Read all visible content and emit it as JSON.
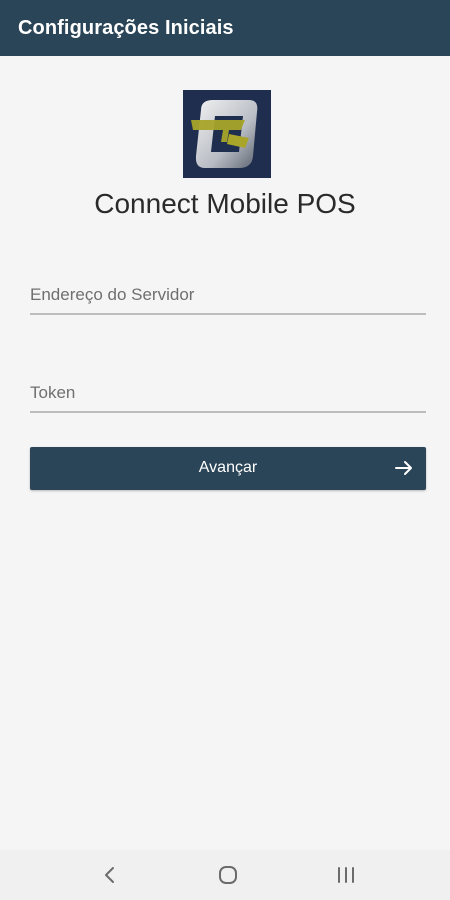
{
  "app_bar": {
    "title": "Configurações Iniciais",
    "color": "#2b4558"
  },
  "logo": {
    "icon": "connect-mobile-pos-logo",
    "background": "#1f2e4f",
    "accent": "#a8a52a"
  },
  "app_name": "Connect Mobile POS",
  "form": {
    "server_field": {
      "value": "",
      "placeholder": "Endereço do Servidor"
    },
    "token_field": {
      "value": "",
      "placeholder": "Token"
    },
    "next_button": {
      "label": "Avançar",
      "icon": "arrow-right-icon"
    }
  },
  "system_nav": {
    "back": "back-icon",
    "home": "home-icon",
    "recents": "recents-icon"
  }
}
